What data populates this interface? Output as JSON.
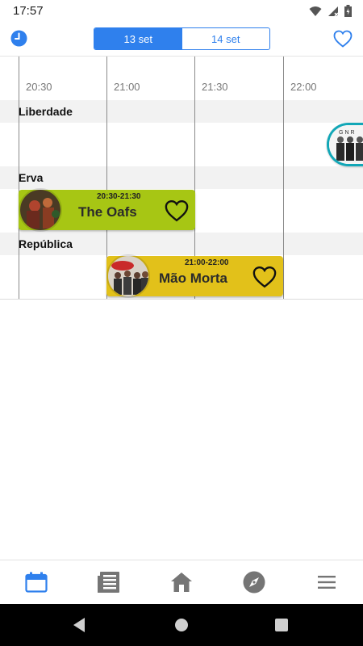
{
  "status_bar": {
    "time": "17:57"
  },
  "header": {
    "date_tabs": [
      {
        "label": "13 set",
        "selected": true
      },
      {
        "label": "14 set",
        "selected": false
      }
    ]
  },
  "timeline": {
    "times": [
      "20:30",
      "21:00",
      "21:30",
      "22:00"
    ],
    "stages": [
      "Liberdade",
      "Erva",
      "República"
    ]
  },
  "events": [
    {
      "stage": "Erva",
      "time": "20:30-21:30",
      "name": "The Oafs",
      "color": "#a7c614"
    },
    {
      "stage": "República",
      "time": "21:00-22:00",
      "name": "Mão Morta",
      "color": "#e2c11a"
    }
  ],
  "partial_event": {
    "stage": "Liberdade",
    "logo_text": "GNR",
    "color": "#12a7b7"
  },
  "bottom_nav": [
    "calendar-icon",
    "news-icon",
    "home-icon",
    "compass-icon",
    "menu-icon"
  ],
  "colors": {
    "accent": "#2f80ed",
    "inactive_nav": "#757575"
  }
}
